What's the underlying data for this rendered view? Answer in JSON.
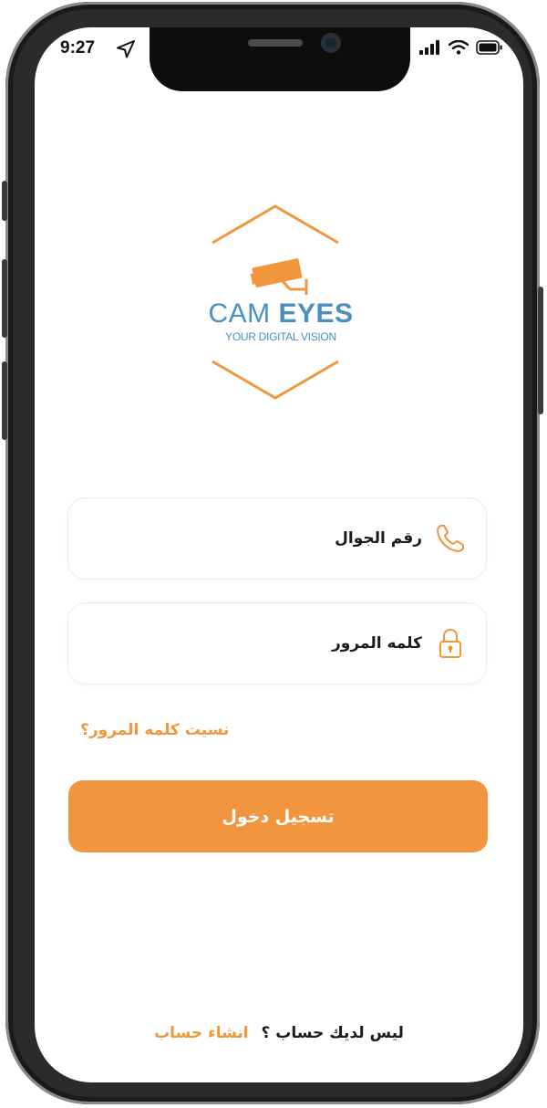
{
  "status_bar": {
    "time": "9:27",
    "icons": [
      "location-arrow-icon",
      "signal-icon",
      "wifi-icon",
      "battery-icon"
    ]
  },
  "logo": {
    "brand_light": "CAM",
    "brand_bold": "EYES",
    "tagline": "YOUR DIGITAL VISION",
    "colors": {
      "orange": "#f0963c",
      "blue": "#4a8fc0"
    }
  },
  "form": {
    "phone_label": "رقم الجوال",
    "phone_icon": "phone-icon",
    "password_label": "كلمه المرور",
    "password_icon": "lock-icon",
    "forgot_password": "نسيت كلمه المرور؟",
    "login_button": "تسجيل دخول"
  },
  "signup": {
    "question": "ليس لديك حساب ؟",
    "link": "انشاء حساب"
  },
  "colors": {
    "accent": "#f1963f",
    "text": "#1a1a1a",
    "border": "#ececec"
  }
}
